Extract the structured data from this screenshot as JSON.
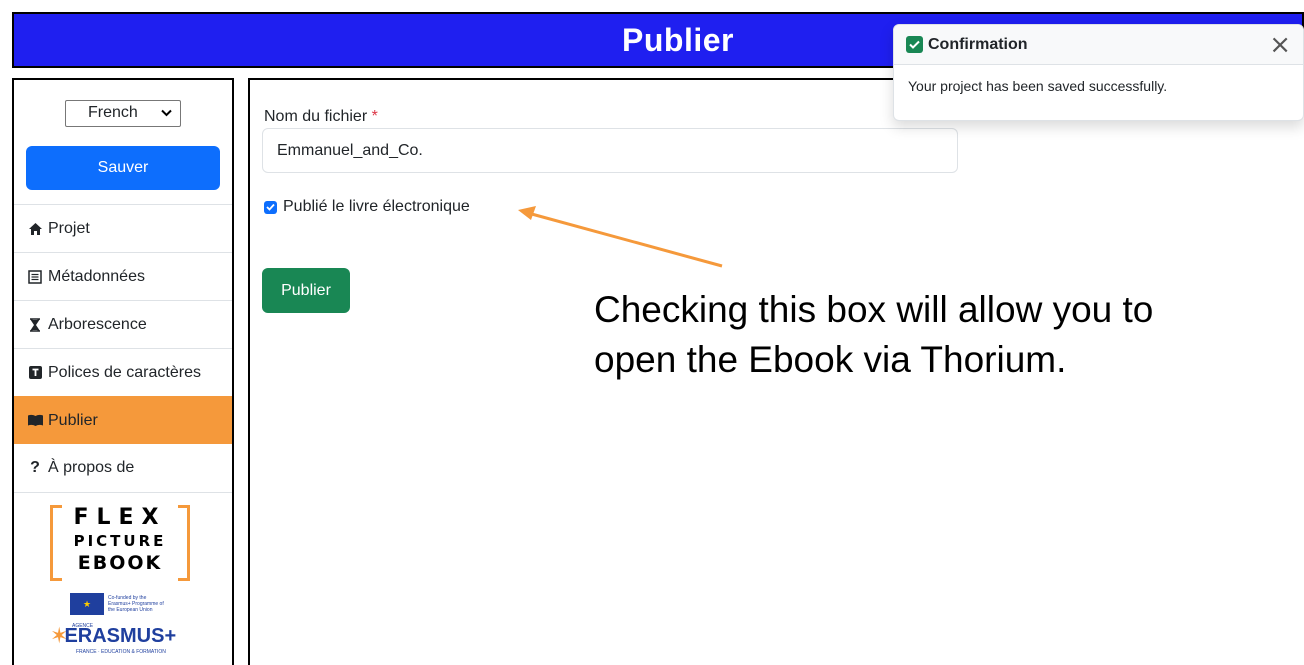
{
  "header": {
    "title": "Publier"
  },
  "sidebar": {
    "language": "French",
    "save_label": "Sauver",
    "items": [
      {
        "label": "Projet",
        "icon": "home-icon"
      },
      {
        "label": "Métadonnées",
        "icon": "list-icon"
      },
      {
        "label": "Arborescence",
        "icon": "hourglass-icon"
      },
      {
        "label": "Polices de caractères",
        "icon": "font-icon"
      },
      {
        "label": "Publier",
        "icon": "book-icon",
        "active": true
      },
      {
        "label": "À propos de",
        "icon": "question-icon"
      }
    ],
    "logo": {
      "line1": "FLEX",
      "line2": "PICTURE",
      "line3": "EBOOK",
      "eu_text": "Co-funded by the Erasmus+ Programme of the European Union",
      "erasmus": "ERASMUS+",
      "erasmus_sub": "FRANCE · EDUCATION & FORMATION",
      "agence": "AGENCE"
    }
  },
  "form": {
    "filename_label": "Nom du fichier",
    "required_mark": "*",
    "filename_value": "Emmanuel_and_Co.",
    "checkbox_label": "Publié le livre électronique",
    "checkbox_checked": true,
    "publish_label": "Publier"
  },
  "annotation": {
    "line1": "Checking this box will allow you to",
    "line2": "open the Ebook via Thorium.",
    "arrow_color": "#f5993b"
  },
  "toast": {
    "title": "Confirmation",
    "message": "Your project has been saved successfully.",
    "close": "×"
  },
  "colors": {
    "header": "#1f1ff0",
    "save": "#0d6efd",
    "active": "#f5993b",
    "publish": "#198754"
  }
}
